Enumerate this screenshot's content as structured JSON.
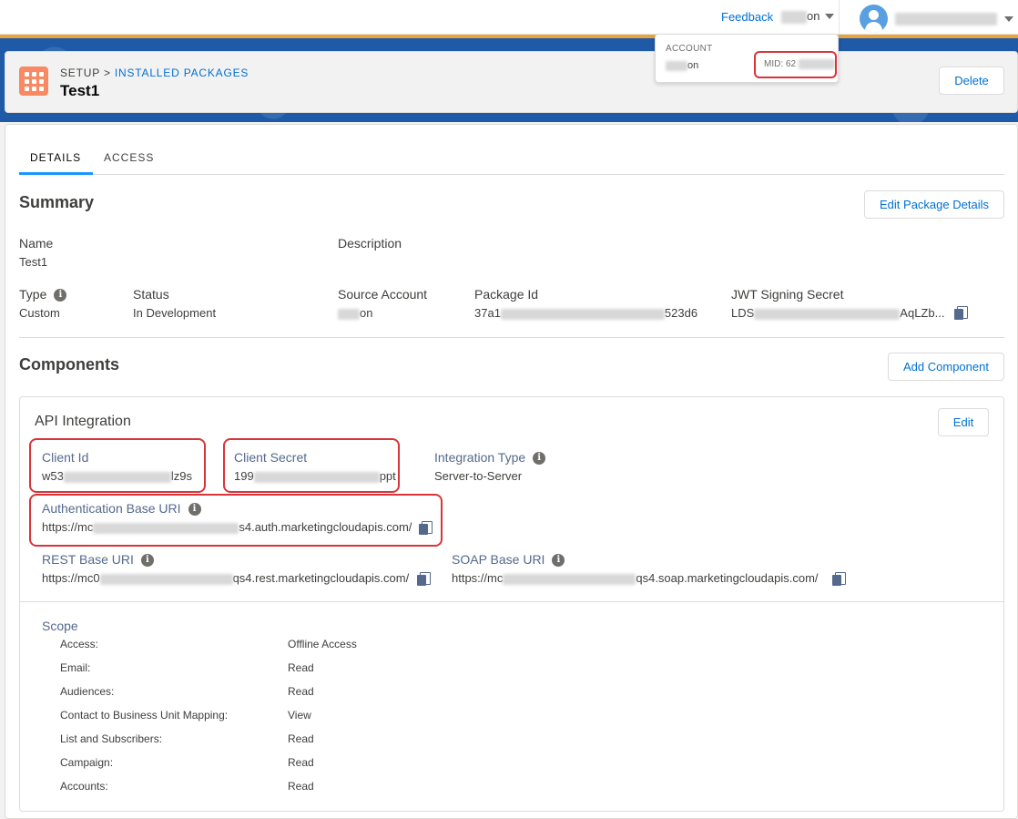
{
  "topbar": {
    "feedback_label": "Feedback",
    "business_unit_visible": "on",
    "user_name_visible": ""
  },
  "account_menu": {
    "label": "ACCOUNT",
    "name_visible": "on",
    "mid_label": "MID: 62"
  },
  "header": {
    "breadcrumb_setup": "SETUP",
    "breadcrumb_separator": ">",
    "breadcrumb_link": "INSTALLED PACKAGES",
    "title": "Test1",
    "delete_label": "Delete"
  },
  "tabs": [
    {
      "label": "DETAILS",
      "active": true
    },
    {
      "label": "ACCESS",
      "active": false
    }
  ],
  "summary": {
    "title": "Summary",
    "edit_label": "Edit Package Details",
    "name_label": "Name",
    "name_value": "Test1",
    "description_label": "Description",
    "type_label": "Type",
    "type_value": "Custom",
    "status_label": "Status",
    "status_value": "In Development",
    "source_account_label": "Source Account",
    "source_account_value_visible": "on",
    "package_id_label": "Package Id",
    "package_id_start": "37a1",
    "package_id_end": "523d6",
    "jwt_label": "JWT Signing Secret",
    "jwt_start": "LDS",
    "jwt_end": "AqLZb..."
  },
  "components": {
    "title": "Components",
    "add_label": "Add Component",
    "api": {
      "title": "API Integration",
      "edit_label": "Edit",
      "client_id_label": "Client Id",
      "client_id_start": "w53",
      "client_id_end": "lz9s",
      "client_secret_label": "Client Secret",
      "client_secret_start": "199",
      "client_secret_end": "ppt",
      "integration_type_label": "Integration Type",
      "integration_type_value": "Server-to-Server",
      "auth_uri_label": "Authentication Base URI",
      "auth_uri_start": "https://mc",
      "auth_uri_end": "s4.auth.marketingcloudapis.com/",
      "rest_uri_label": "REST Base URI",
      "rest_uri_start": "https://mc0",
      "rest_uri_end": "qs4.rest.marketingcloudapis.com/",
      "soap_uri_label": "SOAP Base URI",
      "soap_uri_start": "https://mc",
      "soap_uri_end": "qs4.soap.marketingcloudapis.com/"
    },
    "scope": {
      "title": "Scope",
      "rows": [
        {
          "name": "Access:",
          "value": "Offline Access"
        },
        {
          "name": "Email:",
          "value": "Read"
        },
        {
          "name": "Audiences:",
          "value": "Read"
        },
        {
          "name": "Contact to Business Unit Mapping:",
          "value": "View"
        },
        {
          "name": "List and Subscribers:",
          "value": "Read"
        },
        {
          "name": "Campaign:",
          "value": "Read"
        },
        {
          "name": "Accounts:",
          "value": "Read"
        }
      ]
    }
  },
  "colors": {
    "accent": "#0070d2",
    "highlight": "#d9343a",
    "banner": "#1e5aa8",
    "app_icon": "#f88962"
  }
}
